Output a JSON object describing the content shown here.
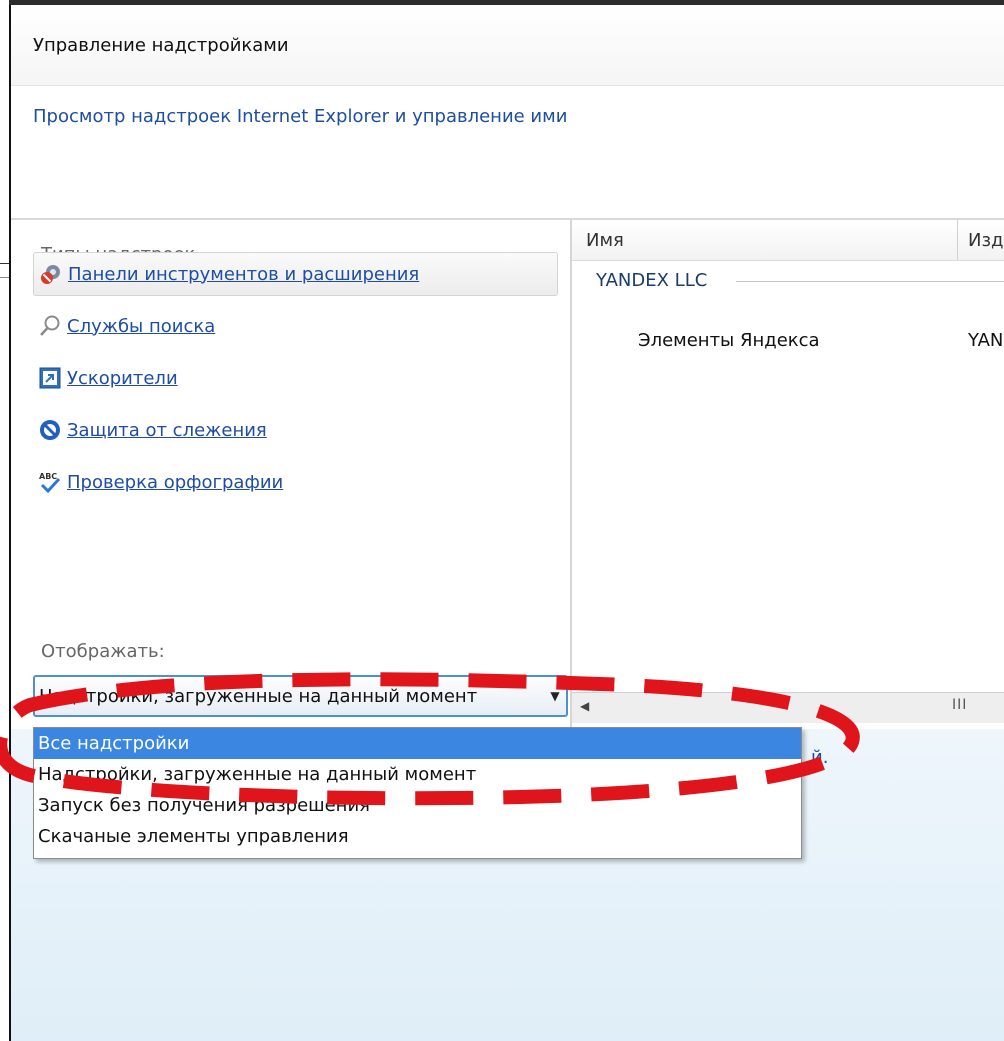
{
  "window": {
    "title": "Управление надстройками",
    "subtitle": "Просмотр надстроек Internet Explorer и управление ими"
  },
  "left_pane": {
    "types_label": "Типы надстроек",
    "categories": [
      {
        "label": "Панели инструментов и расширения",
        "icon": "toolbar-gear-icon",
        "selected": true
      },
      {
        "label": "Службы поиска",
        "icon": "search-icon",
        "selected": false
      },
      {
        "label": "Ускорители",
        "icon": "accelerator-icon",
        "selected": false
      },
      {
        "label": "Защита от слежения",
        "icon": "tracking-protection-icon",
        "selected": false
      },
      {
        "label": "Проверка орфографии",
        "icon": "spelling-icon",
        "selected": false
      }
    ],
    "show_label": "Отображать:",
    "show_value": "Надстройки, загруженные на данный момент"
  },
  "dropdown": {
    "options": [
      "Все надстройки",
      "Надстройки, загруженные на данный момент",
      "Запуск без получения разрешения",
      "Скачаные элементы управления"
    ],
    "selected_index": 0
  },
  "list": {
    "columns": [
      "Имя",
      "Изд"
    ],
    "group": "YANDEX LLC",
    "rows": [
      {
        "name": "Элементы Яндекса",
        "publisher": "YAN"
      }
    ],
    "scroll_grip": "III"
  },
  "bottom": {
    "link_fragment": "й."
  },
  "colors": {
    "link": "#1d4fa0",
    "selection": "#3a86e1",
    "annotation": "#e0141b"
  }
}
